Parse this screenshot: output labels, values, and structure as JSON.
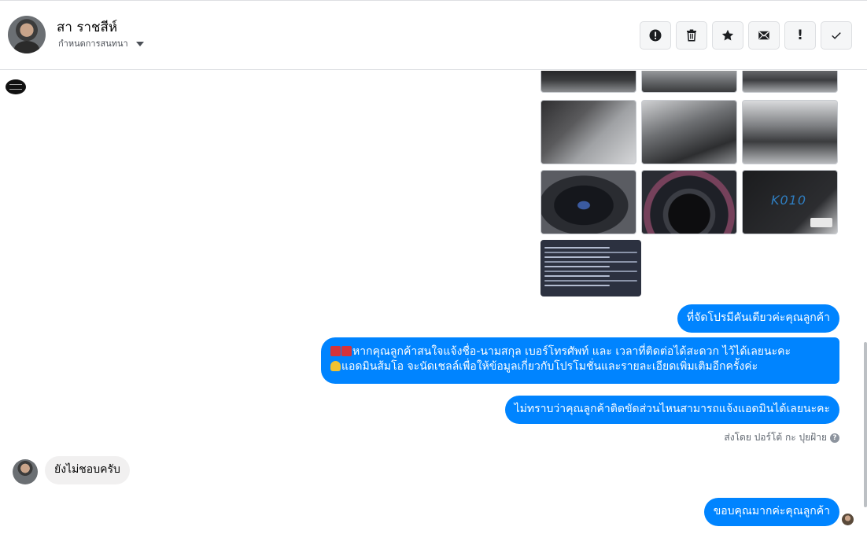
{
  "header": {
    "contact_name": "สา ราชสีห์",
    "assign_label": "กำหนดการสนทนา",
    "actions": [
      {
        "id": "report",
        "icon": "exclamation-circle-icon"
      },
      {
        "id": "delete",
        "icon": "trash-icon"
      },
      {
        "id": "star",
        "icon": "star-icon"
      },
      {
        "id": "mail",
        "icon": "envelope-icon"
      },
      {
        "id": "mark",
        "label": "!"
      },
      {
        "id": "done",
        "icon": "check-icon"
      }
    ]
  },
  "photos": {
    "plate_text": "K010"
  },
  "messages": [
    {
      "from": "page",
      "text": "ที่จัดโปรมีคันเดียวค่ะคุณลูกค้า"
    },
    {
      "from": "page",
      "line1": "หากคุณลูกค้าสนใจแจ้งชื่อ-นามสกุล เบอร์โทรศัพท์ และ เวลาที่ติดต่อได้สะดวก ไว้ได้เลยนะคะ",
      "line2": "แอดมินส้มโอ จะนัดเชลล์เพื่อให้ข้อมูลเกี่ยวกับโปรโมชั่นและรายละเอียดเพิ่มเติมอีกครั้งค่ะ"
    },
    {
      "from": "page",
      "text": "ไม่ทราบว่าคุณลูกค้าติดขัดส่วนไหนสามารถแจ้งแอดมินได้เลยนะคะ"
    },
    {
      "from": "user",
      "text": "ยังไม่ชอบครับ"
    },
    {
      "from": "page",
      "text": "ขอบคุณมากค่ะคุณลูกค้า"
    }
  ],
  "sent_by": "ส่งโดย ปอร์โต้ กะ ปุยฝ้าย",
  "colors": {
    "accent": "#0084ff",
    "incoming": "#f1f0f0"
  }
}
